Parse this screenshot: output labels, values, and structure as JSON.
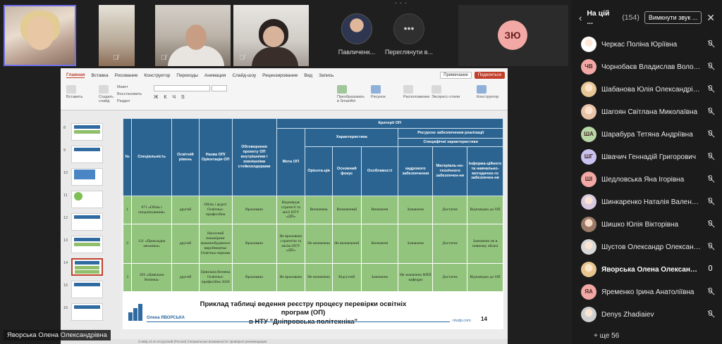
{
  "videos": [
    {
      "name": "",
      "muted": false
    },
    {
      "name": "",
      "muted": true
    },
    {
      "name": "",
      "muted": true
    },
    {
      "name": "",
      "muted": true
    }
  ],
  "avatar_tiles": [
    {
      "name": "Павличенк...",
      "muted": true
    },
    {
      "name": "Переглянути в...",
      "more": "•••"
    }
  ],
  "zu_tile": {
    "initials": "ЗЮ"
  },
  "speaker_label": "Яворська Олена Олександрівна",
  "ribbon": {
    "tabs": [
      "Главная",
      "Вставка",
      "Рисование",
      "Конструктор",
      "Переходы",
      "Анимация",
      "Слайд-шоу",
      "Рецензирование",
      "Вид",
      "Запись"
    ],
    "active_tab": "Главная",
    "notes_button": "Примечание",
    "share_button": "Поделиться",
    "groups": [
      "Вставить",
      "Создать слайд",
      "Макет",
      "Восстановить",
      "Раздел",
      "Преобразовать в SmartArt",
      "Рисунок",
      "Расположение",
      "Экспресс-стили",
      "Конструктор"
    ]
  },
  "thumbnails": [
    "8",
    "9",
    "10",
    "11",
    "12",
    "13",
    "14",
    "15",
    "16"
  ],
  "selected_thumbnail": "14",
  "slide": {
    "table": {
      "header_top": "Критерії ОП",
      "h_num": "№",
      "h_spec": "Спеціальність",
      "h_level": "Освітній рівень",
      "h_name": "Назва ОП/ Орієнтація ОП",
      "h_discuss": "Обговорення проекту ОП внутрішніми і зовнішніми стейкхолдерами",
      "h_goal": "Мета ОП",
      "h_char": "Характеристика",
      "h_resources": "Ресурсне забезпечення реалізації",
      "h_specific": "Специфічні характеристики",
      "h_orient": "Орієнта-ція",
      "h_focus": "Основний фокус",
      "h_features": "Особливості",
      "h_staff": "кадрового забезпечення",
      "h_material": "Матеріаль-но-технічного забезпечен-ня",
      "h_info": "Інформа-ційного та навчально-методично-го забезпечен-ня",
      "rows": [
        [
          "1",
          "071 «Облік і оподаткування»",
          "другий",
          "Облік і аудит/ Освітньо-професійна",
          "Враховано",
          "Відповідає стратегії та місії НТУ «ДП»",
          "Визначена",
          "Визначений",
          "Визначені",
          "Зазначено",
          "Достатнє",
          "Відповідно до ОП"
        ],
        [
          "2",
          "131 «Прикладна механіка»",
          "другий",
          "Насосний інжиніринг машинобудівного виробництва/ Освітньо-наукова",
          "Враховано",
          "Не враховано стратегію та місію НТУ «ДП»",
          "Не визначена",
          "Не визначений",
          "Визначені",
          "Зазначено",
          "Достатнє",
          "Зазначено не в повному обсязі"
        ],
        [
          "3",
          "263 «Цивільна безпека»",
          "другий",
          "Цивільна безпека Освітньо-професійна 2020",
          "Враховано",
          "Не враховано",
          "Не визначена",
          "Відсутній",
          "Зазначено",
          "Не зазначено НПП кафедри",
          "Достатнє",
          "Відповідно до ОП"
        ]
      ]
    },
    "caption_line1": "Приклад таблиці ведення реєстру процесу перевірки освітніх програм (ОП)",
    "caption_line2": "в НТУ \"Дніпровська політехніка\"",
    "author": "Олена ЯВОРСЬКА",
    "site": "ntudp.com",
    "page": "14"
  },
  "status_bar": "Слайд 14 из 24   русский (Россия)   Специальные возможности: проверьте рекомендации",
  "panel": {
    "title": "На цій ...",
    "count": "(154)",
    "mute_all": "Вимкнути звук ...",
    "more": "+ ще 56",
    "participants": [
      {
        "name": "Черкас Поліна Юріївна",
        "initials": "",
        "color": "#fff",
        "photo": true,
        "mic": "off"
      },
      {
        "name": "Чорнобаєв Владислав Володимирович",
        "initials": "ЧВ",
        "color": "#f2a9a6",
        "mic": "off"
      },
      {
        "name": "Шабанова Юлія Олександрівна",
        "initials": "",
        "color": "#e8c797",
        "photo": true,
        "mic": "off"
      },
      {
        "name": "Шагоян Світлана Миколаївна",
        "initials": "",
        "color": "#e7c3a8",
        "photo": true,
        "mic": "off"
      },
      {
        "name": "Шарабура Тетяна Андріївна",
        "initials": "ША",
        "color": "#b8d8a8",
        "mic": "off"
      },
      {
        "name": "Швачич Геннадій Григорович",
        "initials": "ШГ",
        "color": "#c8c4ef",
        "mic": "off"
      },
      {
        "name": "Шедловська Яна Ігорівна",
        "initials": "ШІ",
        "color": "#f2a9a6",
        "mic": "off"
      },
      {
        "name": "Шинкаренко Наталія Валентинівна",
        "initials": "",
        "color": "#d9c9e0",
        "photo": true,
        "mic": "off"
      },
      {
        "name": "Шишко Юлія Вікторівна",
        "initials": "",
        "color": "#9a7a66",
        "photo": true,
        "mic": "off"
      },
      {
        "name": "Шустов Олександр Олександрович",
        "initials": "",
        "color": "#d8d8d8",
        "photo": true,
        "mic": "off"
      },
      {
        "name": "Яворська Олена Олександрівна",
        "initials": "",
        "color": "#e6c58f",
        "photo": true,
        "mic": "on",
        "bold": true
      },
      {
        "name": "Яременко Ірина Анатоліївна",
        "initials": "ЯА",
        "color": "#f2a9a6",
        "mic": "off"
      },
      {
        "name": "Denys Zhadiaiev",
        "initials": "",
        "color": "#cfcfcf",
        "photo": true,
        "mic": "off"
      }
    ]
  }
}
